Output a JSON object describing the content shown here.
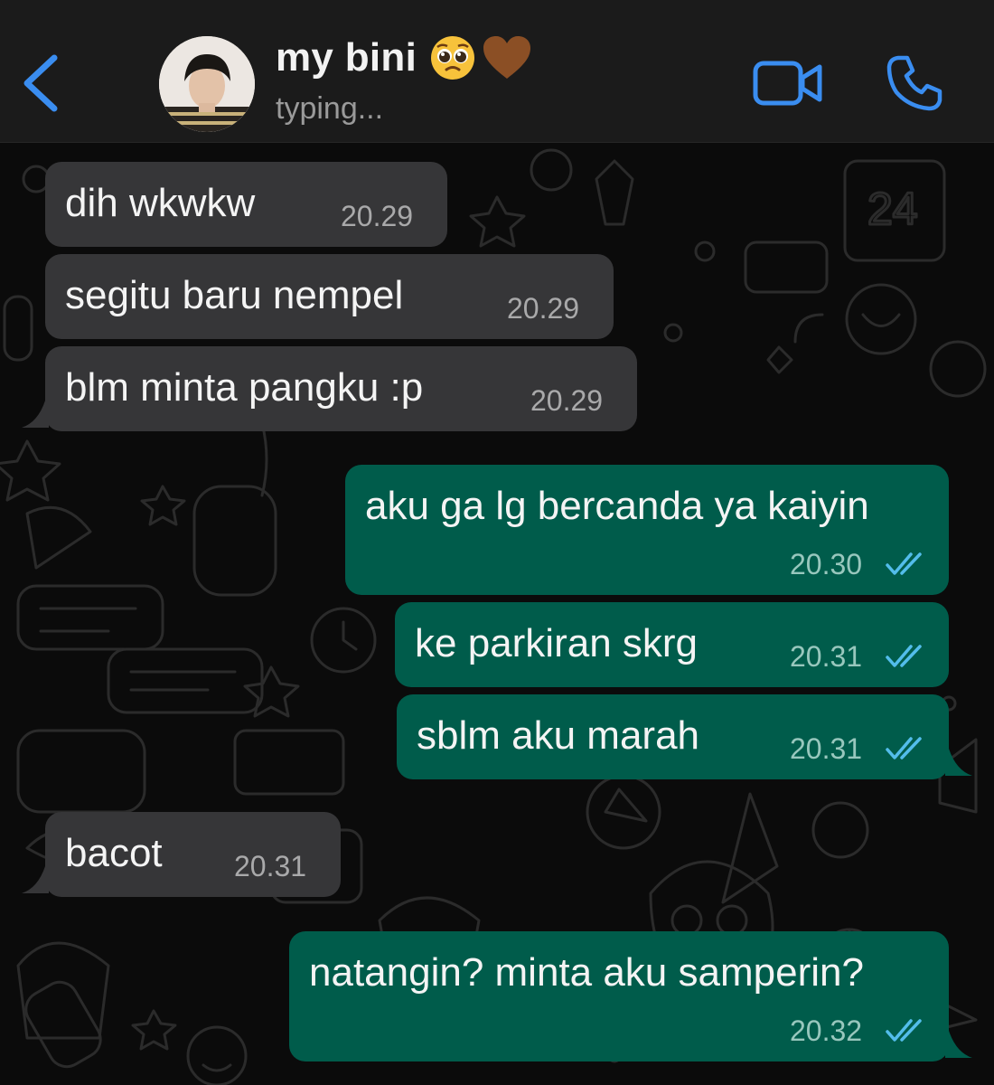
{
  "header": {
    "contact_name": "my bini",
    "status": "typing...",
    "emojis": [
      "pleading-face",
      "brown-heart"
    ],
    "colors": {
      "accent": "#3a8df0",
      "bar": "#1b1b1b"
    }
  },
  "messages": [
    {
      "direction": "incoming",
      "text": "dih wkwkw",
      "time": "20.29"
    },
    {
      "direction": "incoming",
      "text": "segitu baru nempel",
      "time": "20.29"
    },
    {
      "direction": "incoming",
      "text": "blm minta pangku :p",
      "time": "20.29"
    },
    {
      "direction": "outgoing",
      "text": "aku ga lg bercanda ya kaiyin",
      "time": "20.30",
      "read": true
    },
    {
      "direction": "outgoing",
      "text": "ke parkiran skrg",
      "time": "20.31",
      "read": true
    },
    {
      "direction": "outgoing",
      "text": "sblm aku marah",
      "time": "20.31",
      "read": true
    },
    {
      "direction": "incoming",
      "text": "bacot",
      "time": "20.31"
    },
    {
      "direction": "outgoing",
      "text": "natangin? minta aku samperin?",
      "time": "20.32",
      "read": true
    }
  ],
  "colors": {
    "incoming_bubble": "#363638",
    "outgoing_bubble": "#005c4b",
    "read_ticks": "#53bdeb"
  }
}
